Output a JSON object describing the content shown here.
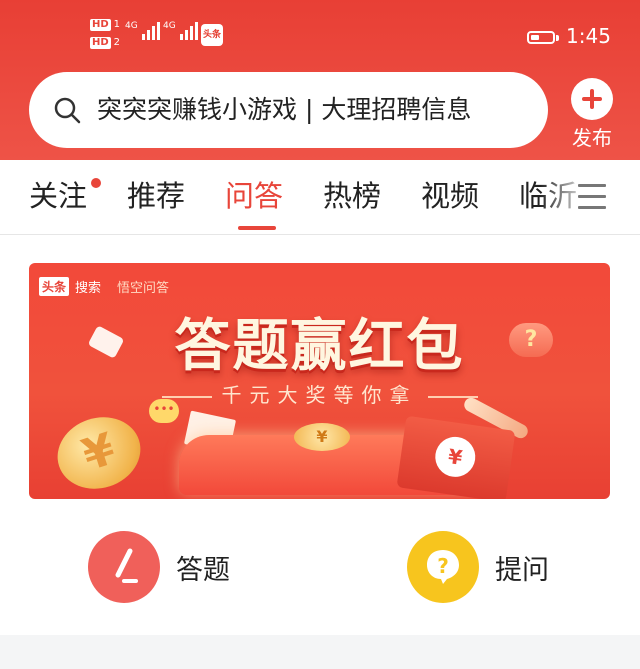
{
  "status_bar": {
    "sim1": "HD",
    "sim1_index": "1",
    "sim2": "HD",
    "sim2_index": "2",
    "net1": "4G",
    "net2": "4G",
    "app_badge": "头条",
    "battery_level_percent": 40,
    "time": "1:45"
  },
  "search": {
    "icon": "search-icon",
    "text": "突突突赚钱小游戏 | 大理招聘信息"
  },
  "publish": {
    "icon": "plus-icon",
    "label": "发布"
  },
  "tabs": {
    "items": [
      {
        "label": "关注",
        "has_dot": true
      },
      {
        "label": "推荐"
      },
      {
        "label": "问答",
        "active": true
      },
      {
        "label": "热榜"
      },
      {
        "label": "视频"
      },
      {
        "label": "临沂"
      }
    ],
    "menu_icon": "hamburger-icon",
    "accent_color": "#e8453a"
  },
  "banner": {
    "logo_brand": "头条",
    "logo_search": "搜索",
    "logo_partner": "悟空问答",
    "headline": "答题赢红包",
    "subline": "千元大奖等你拿",
    "coin_symbol": "¥"
  },
  "actions": [
    {
      "label": "答题",
      "icon": "pencil-icon",
      "color": "#f0605a"
    },
    {
      "label": "提问",
      "icon": "question-bubble-icon",
      "color": "#f7c51e"
    }
  ]
}
